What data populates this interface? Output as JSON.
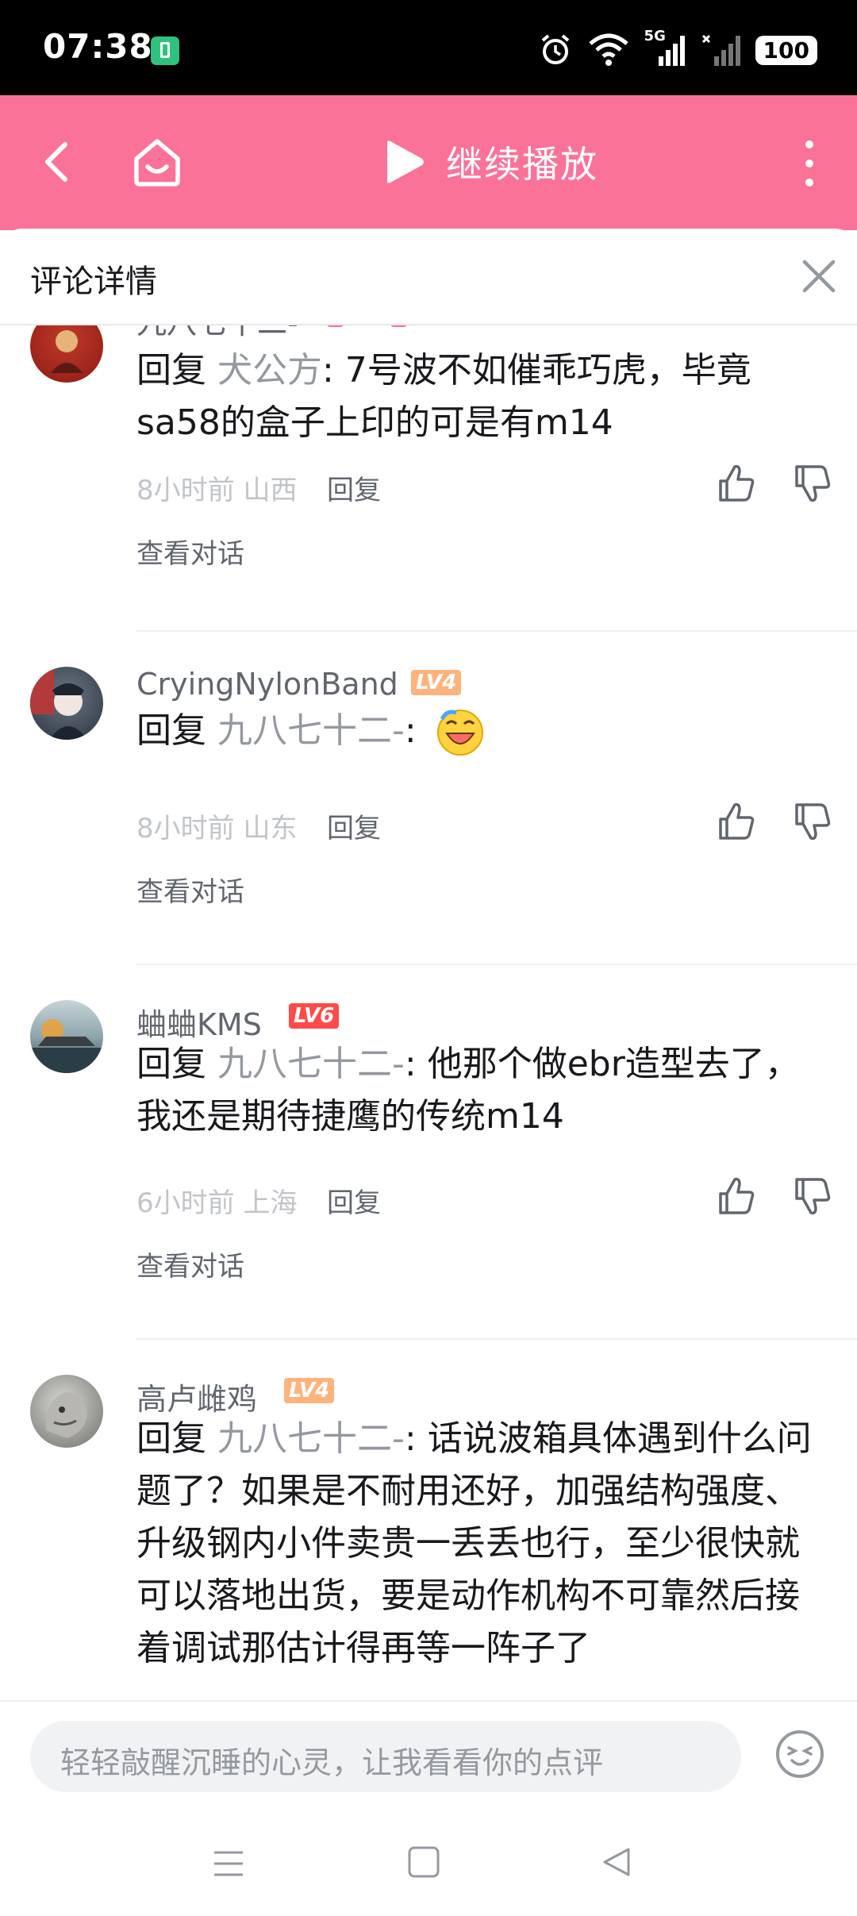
{
  "status_bar": {
    "time": "07:38",
    "network": "5G",
    "battery": "100",
    "icons": [
      "battery-saver-icon",
      "alarm-icon",
      "wifi-icon",
      "signal-icon",
      "signal-icon"
    ]
  },
  "header": {
    "background": "#fb7299",
    "play_label": "继续播放"
  },
  "sheet": {
    "title": "评论详情"
  },
  "comments": [
    {
      "username": "九八七十二-",
      "reply_word": "回复",
      "reply_target": "犬公方",
      "text": ": 7号波不如催乖巧虎，毕竟sa58的盒子上印的可是有m14",
      "time_loc": "8小时前 山西",
      "reply_label": "回复",
      "view_label": "查看对话"
    },
    {
      "username": "CryingNylonBand",
      "level": "LV4",
      "reply_word": "回复",
      "reply_target": "九八七十二-",
      "text": ":",
      "emoji": "laughing-face-emoji",
      "time_loc": "8小时前 山东",
      "reply_label": "回复",
      "view_label": "查看对话"
    },
    {
      "username": "蛐蛐KMS",
      "level": "LV6",
      "reply_word": "回复",
      "reply_target": "九八七十二-",
      "text": ": 他那个做ebr造型去了，我还是期待捷鹰的传统m14",
      "time_loc": "6小时前 上海",
      "reply_label": "回复",
      "view_label": "查看对话"
    },
    {
      "username": "高卢雌鸡",
      "level": "LV4",
      "reply_word": "回复",
      "reply_target": "九八七十二-",
      "text": ": 话说波箱具体遇到什么问题了？如果是不耐用还好，加强结构强度、升级钢内小件卖贵一丢丢也行，至少很快就可以落地出货，要是动作机构不可靠然后接着调试那估计得再等一阵子了"
    }
  ],
  "input": {
    "placeholder": "轻轻敲醒沉睡的心灵，让我看看你的点评"
  },
  "colors": {
    "lv4": "#ffb37c",
    "lv6": "#ff4a4a",
    "accent": "#fb7299"
  }
}
